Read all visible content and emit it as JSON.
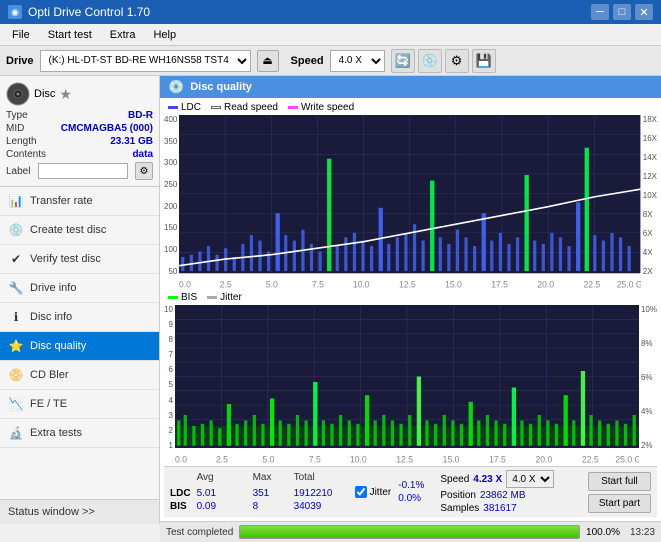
{
  "titlebar": {
    "title": "Opti Drive Control 1.70",
    "icon": "◉",
    "minimize": "─",
    "maximize": "□",
    "close": "✕"
  },
  "menubar": {
    "items": [
      "File",
      "Start test",
      "Extra",
      "Help"
    ]
  },
  "drivebar": {
    "drive_label": "Drive",
    "drive_value": "(K:)  HL-DT-ST BD-RE  WH16NS58 TST4",
    "speed_label": "Speed",
    "speed_value": "4.0 X"
  },
  "disc": {
    "header": "Disc",
    "type_label": "Type",
    "type_value": "BD-R",
    "mid_label": "MID",
    "mid_value": "CMCMAGBA5 (000)",
    "length_label": "Length",
    "length_value": "23.31 GB",
    "contents_label": "Contents",
    "contents_value": "data",
    "label_label": "Label",
    "label_value": ""
  },
  "nav": {
    "items": [
      {
        "id": "transfer-rate",
        "label": "Transfer rate",
        "icon": "📊"
      },
      {
        "id": "create-test-disc",
        "label": "Create test disc",
        "icon": "💿"
      },
      {
        "id": "verify-test-disc",
        "label": "Verify test disc",
        "icon": "✔"
      },
      {
        "id": "drive-info",
        "label": "Drive info",
        "icon": "🔧"
      },
      {
        "id": "disc-info",
        "label": "Disc info",
        "icon": "ℹ"
      },
      {
        "id": "disc-quality",
        "label": "Disc quality",
        "icon": "⭐",
        "active": true
      },
      {
        "id": "cd-bler",
        "label": "CD Bler",
        "icon": "📀"
      },
      {
        "id": "fe-te",
        "label": "FE / TE",
        "icon": "📉"
      },
      {
        "id": "extra-tests",
        "label": "Extra tests",
        "icon": "🔬"
      }
    ],
    "status_window": "Status window >>"
  },
  "content": {
    "header": "Disc quality",
    "chart_top": {
      "legend": [
        {
          "label": "LDC",
          "color": "#0000ff"
        },
        {
          "label": "Read speed",
          "color": "#ffffff"
        },
        {
          "label": "Write speed",
          "color": "#ff00ff"
        }
      ],
      "y_axis_left": [
        "400",
        "350",
        "300",
        "250",
        "200",
        "150",
        "100",
        "50"
      ],
      "y_axis_right": [
        "18X",
        "16X",
        "14X",
        "12X",
        "10X",
        "8X",
        "6X",
        "4X",
        "2X"
      ],
      "x_axis": [
        "0.0",
        "2.5",
        "5.0",
        "7.5",
        "10.0",
        "12.5",
        "15.0",
        "17.5",
        "20.0",
        "22.5",
        "25.0 GB"
      ]
    },
    "chart_bottom": {
      "legend": [
        {
          "label": "BIS",
          "color": "#00ff00"
        },
        {
          "label": "Jitter",
          "color": "#ffffff"
        }
      ],
      "y_axis_left": [
        "10",
        "9",
        "8",
        "7",
        "6",
        "5",
        "4",
        "3",
        "2",
        "1"
      ],
      "y_axis_right": [
        "10%",
        "8%",
        "6%",
        "4%",
        "2%"
      ],
      "x_axis": [
        "0.0",
        "2.5",
        "5.0",
        "7.5",
        "10.0",
        "12.5",
        "15.0",
        "17.5",
        "20.0",
        "22.5",
        "25.0 GB"
      ]
    }
  },
  "stats": {
    "columns": [
      "",
      "LDC",
      "BIS",
      "",
      "Jitter",
      "Speed",
      ""
    ],
    "rows": [
      {
        "label": "Avg",
        "ldc": "5.01",
        "bis": "0.09",
        "jitter": "-0.1%",
        "speed_label": "Position",
        "speed_val": "23862 MB"
      },
      {
        "label": "Max",
        "ldc": "351",
        "bis": "8",
        "jitter": "0.0%",
        "speed_label": "Samples",
        "speed_val": "381617"
      },
      {
        "label": "Total",
        "ldc": "1912210",
        "bis": "34039",
        "jitter": "",
        "speed_label": "",
        "speed_val": ""
      }
    ],
    "jitter_checked": true,
    "jitter_label": "Jitter",
    "speed_label": "Speed",
    "speed_value": "4.23 X",
    "speed_select": "4.0 X",
    "start_full": "Start full",
    "start_part": "Start part"
  },
  "progress": {
    "status_text": "Test completed",
    "percent": 100,
    "time": "13:23"
  }
}
